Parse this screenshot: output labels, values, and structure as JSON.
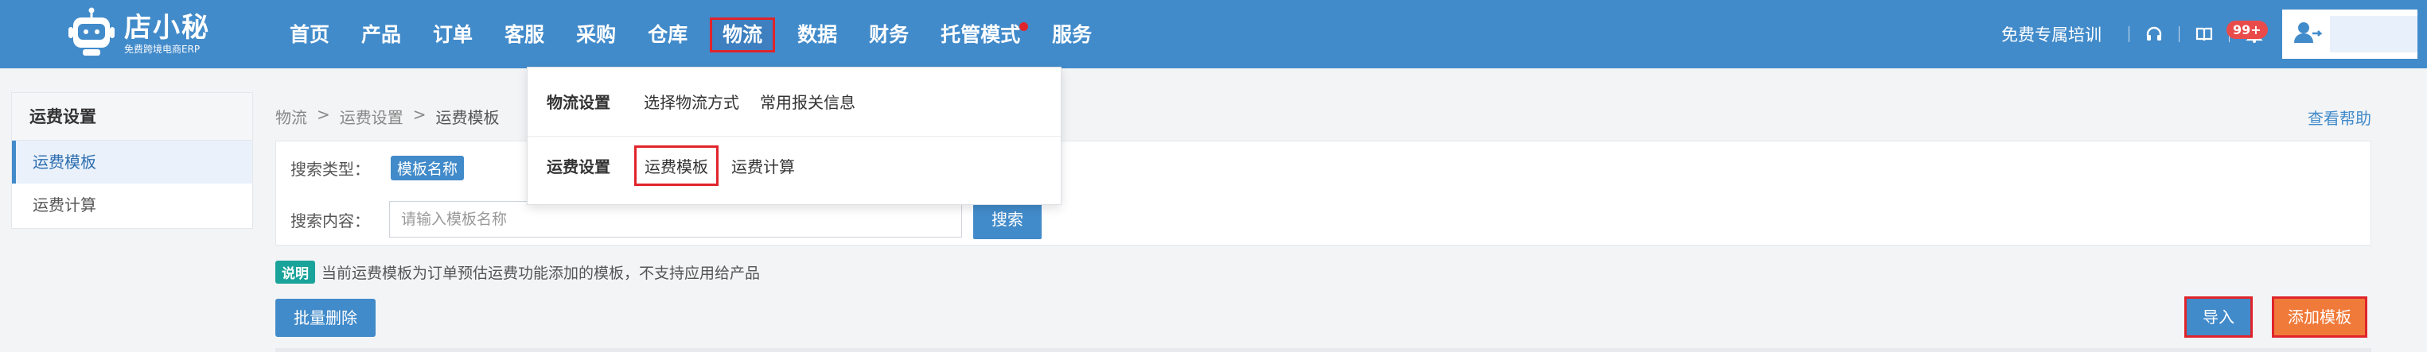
{
  "brand": {
    "name": "店小秘",
    "tagline": "免费跨境电商ERP"
  },
  "nav": {
    "items": [
      {
        "label": "首页"
      },
      {
        "label": "产品"
      },
      {
        "label": "订单"
      },
      {
        "label": "客服"
      },
      {
        "label": "采购"
      },
      {
        "label": "仓库"
      },
      {
        "label": "物流"
      },
      {
        "label": "数据"
      },
      {
        "label": "财务"
      },
      {
        "label": "托管模式"
      },
      {
        "label": "服务"
      }
    ]
  },
  "header_right": {
    "training": "免费专属培训",
    "notification_badge": "99+"
  },
  "dropdown": {
    "group1": {
      "title": "物流设置",
      "links": [
        "选择物流方式",
        "常用报关信息"
      ]
    },
    "group2": {
      "title": "运费设置",
      "links": [
        "运费模板",
        "运费计算"
      ]
    }
  },
  "sidebar": {
    "title": "运费设置",
    "items": [
      {
        "label": "运费模板"
      },
      {
        "label": "运费计算"
      }
    ]
  },
  "breadcrumb": {
    "items": [
      "物流",
      "运费设置",
      "运费模板"
    ],
    "separator": ">"
  },
  "help_link": "查看帮助",
  "search": {
    "type_label": "搜索类型：",
    "type_value": "模板名称",
    "content_label": "搜索内容：",
    "placeholder": "请输入模板名称",
    "button": "搜索"
  },
  "note": {
    "tag": "说明",
    "text": "当前运费模板为订单预估运费功能添加的模板，不支持应用给产品"
  },
  "actions": {
    "batch_delete": "批量删除",
    "import": "导入",
    "add_template": "添加模板"
  },
  "colors": {
    "primary": "#428bca",
    "highlight": "#e0242b",
    "accent_orange": "#f07a3a",
    "note_tag": "#1aa39a"
  }
}
